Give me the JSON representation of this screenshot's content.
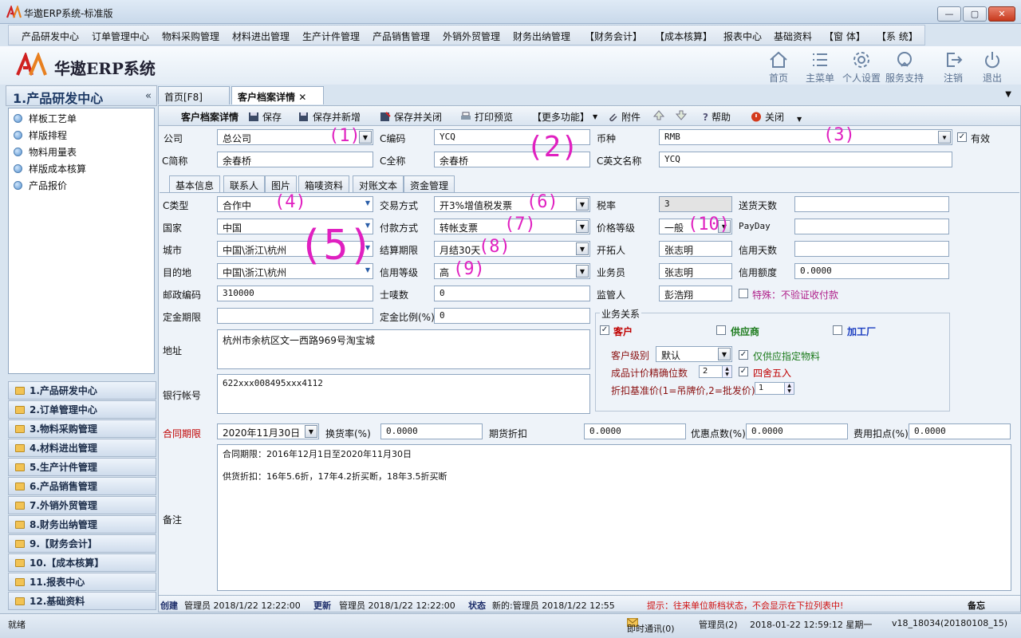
{
  "window": {
    "title": "华遨ERP系统-标准版",
    "min": "—",
    "max": "▢",
    "close": "✕"
  },
  "menu": [
    "产品研发中心",
    "订单管理中心",
    "物料采购管理",
    "材料进出管理",
    "生产计件管理",
    "产品销售管理",
    "外销外贸管理",
    "财务出纳管理",
    "【财务会计】",
    "【成本核算】",
    "报表中心",
    "基础资料",
    "【窗  体】",
    "【系  统】"
  ],
  "brand": {
    "name": "华遨ERP系统"
  },
  "topbuttons": [
    {
      "label": "首页",
      "icon": "home-icon"
    },
    {
      "label": "主菜单",
      "icon": "menu-list-icon"
    },
    {
      "label": "个人设置",
      "icon": "gear-icon"
    },
    {
      "label": "服务支持",
      "icon": "support-icon"
    },
    {
      "label": "注销",
      "icon": "logout-icon"
    },
    {
      "label": "退出",
      "icon": "power-icon"
    }
  ],
  "left": {
    "header": "1.产品研发中心",
    "collapse": "«",
    "tree": [
      "样板工艺单",
      "样版排程",
      "物料用量表",
      "样版成本核算",
      "产品报价"
    ],
    "nav": [
      "1.产品研发中心",
      "2.订单管理中心",
      "3.物料采购管理",
      "4.材料进出管理",
      "5.生产计件管理",
      "6.产品销售管理",
      "7.外销外贸管理",
      "8.财务出纳管理",
      "9.【财务会计】",
      "10.【成本核算】",
      "11.报表中心",
      "12.基础资料"
    ]
  },
  "tabs": {
    "home": "首页[F8]",
    "detail": "客户档案详情",
    "close": "✕"
  },
  "toolbar": {
    "title": "客户档案详情",
    "save": "保存",
    "save_new": "保存并新增",
    "save_close": "保存并关闭",
    "print": "打印预览",
    "more": "【更多功能】",
    "attach": "附件",
    "help": "帮助",
    "close": "关闭"
  },
  "form": {
    "company_label": "公司",
    "company": "总公司",
    "code_label": "C编码",
    "code": "YCQ",
    "currency_label": "币种",
    "currency": "RMB",
    "valid_label": "有效",
    "short_label": "C简称",
    "short": "余春桥",
    "full_label": "C全称",
    "full": "余春桥",
    "en_label": "C英文名称",
    "en": "YCQ"
  },
  "innertabs": [
    "基本信息",
    "联系人",
    "图片",
    "箱唛资料",
    "对账文本",
    "资金管理"
  ],
  "basic": {
    "ctype_label": "C类型",
    "ctype": "合作中",
    "trade_label": "交易方式",
    "trade": "开3%增值税发票",
    "tax_label": "税率",
    "tax": "3",
    "delivery_label": "送货天数",
    "delivery": "",
    "country_label": "国家",
    "country": "中国",
    "pay_label": "付款方式",
    "pay": "转帐支票",
    "price_label": "价格等级",
    "price": "一般",
    "payday_label": "PayDay",
    "payday": "",
    "city_label": "城市",
    "city": "中国\\浙江\\杭州",
    "settle_label": "结算期限",
    "settle": "月结30天",
    "dev_label": "开拓人",
    "dev": "张志明",
    "creditdays_label": "信用天数",
    "creditdays": "",
    "dest_label": "目的地",
    "dest": "中国\\浙江\\杭州",
    "credit_label": "信用等级",
    "credit": "高",
    "sales_label": "业务员",
    "sales": "张志明",
    "limit_label": "信用额度",
    "limit": "0.0000",
    "zip_label": "邮政编码",
    "zip": "310000",
    "mark_label": "士唛数",
    "mark": "0",
    "supervisor_label": "监管人",
    "supervisor": "彭浩翔",
    "special": "特殊：不验证收付款",
    "deposit_label": "定金期限",
    "deposit": "",
    "depositrate_label": "定金比例(%)",
    "depositrate": "0",
    "addr_label": "地址",
    "addr": "杭州市余杭区文一西路969号淘宝城",
    "bank_label": "银行帐号",
    "bank": "622xxx008495xxx4112"
  },
  "biz": {
    "title": "业务关系",
    "customer": "客户",
    "supplier": "供应商",
    "factory": "加工厂",
    "level_label": "客户级别",
    "level": "默认",
    "only_supply": "仅供应指定物料",
    "precision_label": "成品计价精确位数",
    "precision": "2",
    "round": "四舍五入",
    "discount_label": "折扣基准价(1=吊牌价,2=批发价)",
    "discount": "1"
  },
  "contract": {
    "label": "合同期限",
    "date": "2020年11月30日",
    "exchange_label": "换货率(%)",
    "exchange": "0.0000",
    "futures_label": "期货折扣",
    "futures": "0.0000",
    "points_label": "优惠点数(%)",
    "points": "0.0000",
    "fee_label": "费用扣点(%)",
    "fee": "0.0000"
  },
  "remark": {
    "label": "备注",
    "line1": "合同期限：2016年12月1日至2020年11月30日",
    "line2": "供货折扣：16年5.6折，17年4.2折买断，18年3.5折买断"
  },
  "annotations": [
    "(1)",
    "(2)",
    "(3)",
    "(4)",
    "(5)",
    "(6)",
    "(7)",
    "(8)",
    "(9)",
    "(10)"
  ],
  "info": {
    "create_label": "创建",
    "create": "管理员  2018/1/22 12:22:00",
    "update_label": "更新",
    "update": "管理员  2018/1/22 12:22:00",
    "state_label": "状态",
    "state": "新的:管理员  2018/1/22 12:55",
    "tip": "提示：往来单位新档状态，不会显示在下拉列表中!",
    "memo": "备忘"
  },
  "status": {
    "ready": "就绪",
    "im": "即时通讯(0)",
    "user": "管理员(2)",
    "datetime": "2018-01-22  12:59:12  星期一",
    "version": "v18_18034(20180108_15)"
  },
  "colors": {
    "accent": "#1f3b66",
    "annotation": "#e020c0",
    "required": "#c00000"
  }
}
